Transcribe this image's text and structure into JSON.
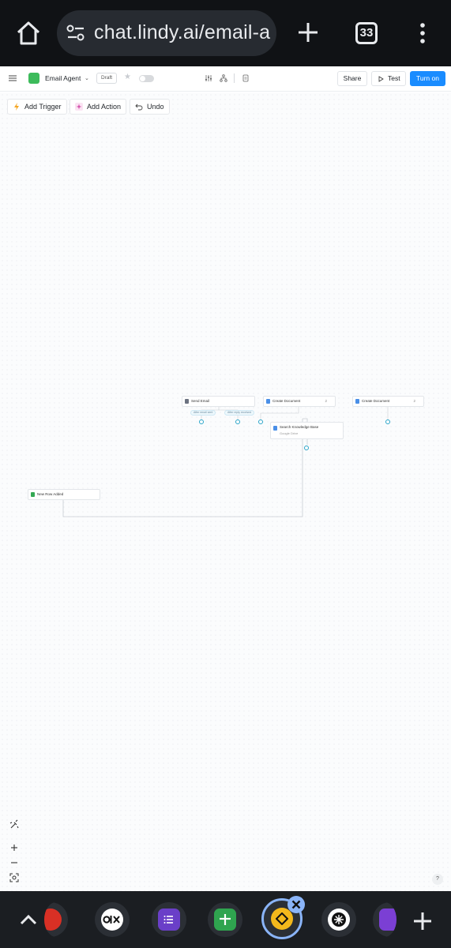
{
  "browser": {
    "url": "chat.lindy.ai/email-a",
    "tab_count": "33"
  },
  "header": {
    "agent_name": "Email Agent",
    "status_badge": "Draft",
    "share_label": "Share",
    "test_label": "Test",
    "turn_on_label": "Turn on"
  },
  "canvas_toolbar": {
    "add_trigger": "Add Trigger",
    "add_action": "Add Action",
    "undo": "Undo"
  },
  "nodes": {
    "send_email": "Send Email",
    "create_document_1": "Create Document",
    "create_document_1_count": "2",
    "create_document_2": "Create Document",
    "create_document_2_count": "2",
    "search_kb": "Search Knowledge Base",
    "search_kb_sub": "Google Drive",
    "new_row": "New Row Added",
    "branch_after_sent": "After email sent",
    "branch_after_reply": "After reply received"
  },
  "help_label": "?",
  "colors": {
    "accent": "#1a8cff",
    "agent_logo": "#3dbb5b",
    "connector": "#2ba5c9"
  },
  "icons": [
    "home-icon",
    "site-settings-icon",
    "new-tab-icon",
    "more-vert-icon",
    "hamburger-icon",
    "star-icon",
    "share-icon",
    "play-icon",
    "bolt-icon",
    "sparkle-icon",
    "undo-icon",
    "clean-icon",
    "zoom-in-icon",
    "zoom-out-icon",
    "fit-view-icon"
  ]
}
